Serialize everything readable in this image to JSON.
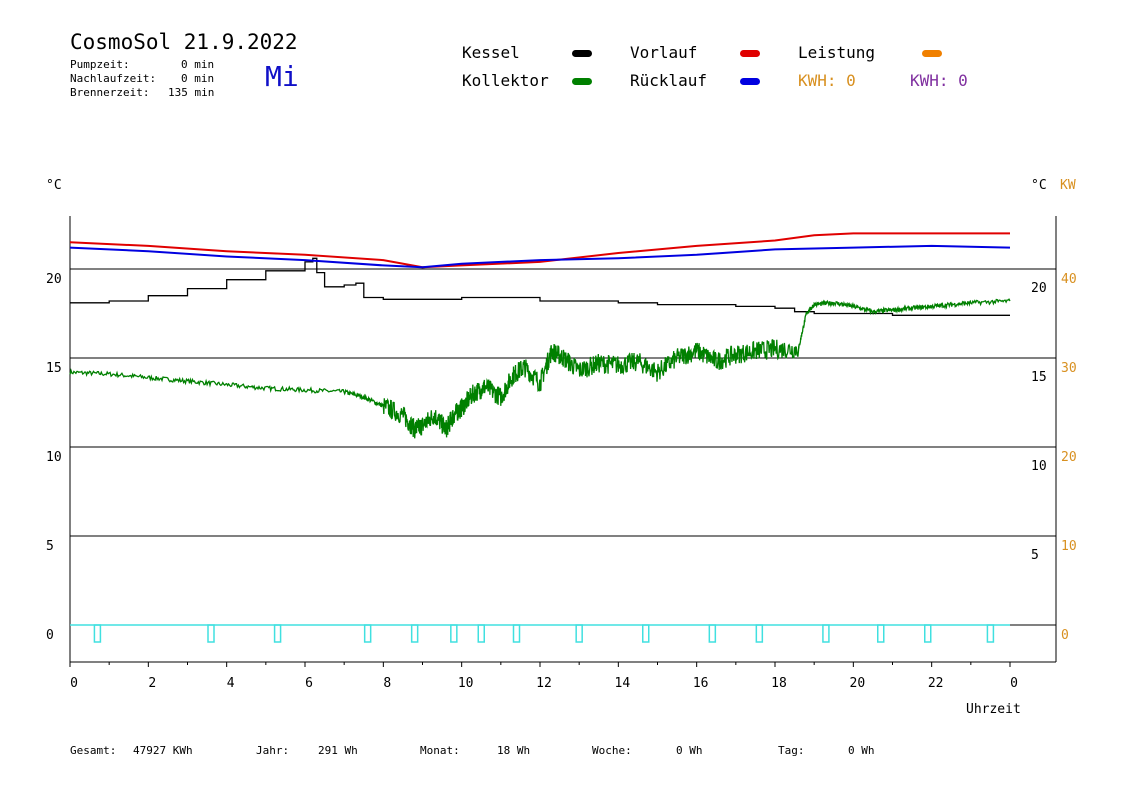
{
  "header": {
    "title": "CosmoSol 21.9.2022",
    "weekday": "Mi",
    "stats": [
      {
        "label": "Pumpzeit:",
        "value": "0 min"
      },
      {
        "label": "Nachlaufzeit:",
        "value": "0 min"
      },
      {
        "label": "Brennerzeit:",
        "value": "135 min"
      }
    ]
  },
  "legend": {
    "kessel": "Kessel",
    "vorlauf": "Vorlauf",
    "leistung": "Leistung",
    "kollektor": "Kollektor",
    "ruecklauf": "Rücklauf",
    "kwh1": "KWH: 0",
    "kwh2": "KWH: 0"
  },
  "axes": {
    "left_unit": "°C",
    "right_unit": "°C",
    "right_unit2": "KW",
    "xlabel": "Uhrzeit"
  },
  "footer": {
    "gesamt_label": "Gesamt:",
    "gesamt_value": "47927 KWh",
    "jahr_label": "Jahr:",
    "jahr_value": "291 Wh",
    "monat_label": "Monat:",
    "monat_value": "18 Wh",
    "woche_label": "Woche:",
    "woche_value": "0 Wh",
    "tag_label": "Tag:",
    "tag_value": "0 Wh"
  },
  "colors": {
    "kessel": "#000000",
    "kollektor": "#008000",
    "vorlauf": "#e00000",
    "ruecklauf": "#0000e0",
    "leistung": "#f08000",
    "kwh_orange": "#d89020",
    "kwh_purple": "#8030a0",
    "pump": "#40e0e0"
  },
  "chart_data": {
    "type": "line",
    "title": "CosmoSol 21.9.2022",
    "xlabel": "Uhrzeit",
    "ylabel": "°C",
    "xlim": [
      0,
      24
    ],
    "ylim": [
      -2,
      23
    ],
    "y2lim": [
      -4,
      46
    ],
    "y2label": "KW",
    "x_ticks": [
      "0",
      "2",
      "4",
      "6",
      "8",
      "10",
      "12",
      "14",
      "16",
      "18",
      "20",
      "22",
      "0"
    ],
    "y_left_ticks": [
      0,
      5,
      10,
      15,
      20
    ],
    "y_right_ticks": [
      5,
      10,
      15,
      20
    ],
    "y2_ticks": [
      0,
      10,
      20,
      30,
      40
    ],
    "grid": true,
    "series": [
      {
        "name": "Kessel",
        "x": [
          0,
          1,
          2,
          3,
          4,
          5,
          6,
          6.2,
          6.3,
          6.5,
          7,
          7.3,
          7.5,
          8,
          9,
          10,
          11,
          12,
          13,
          14,
          15,
          16,
          17,
          18,
          18.5,
          19,
          20,
          21,
          22,
          23,
          24
        ],
        "y": [
          18.1,
          18.2,
          18.5,
          18.9,
          19.4,
          19.9,
          20.4,
          20.6,
          19.8,
          19.0,
          19.1,
          19.2,
          18.4,
          18.3,
          18.3,
          18.4,
          18.4,
          18.2,
          18.2,
          18.1,
          18.0,
          18.0,
          17.9,
          17.8,
          17.6,
          17.5,
          17.5,
          17.4,
          17.4,
          17.4,
          17.4
        ]
      },
      {
        "name": "Kollektor",
        "x": [
          0,
          1,
          2,
          3,
          4,
          5,
          6,
          7,
          7.5,
          8,
          8.5,
          8.8,
          9,
          9.3,
          9.6,
          9.8,
          10,
          10.3,
          10.6,
          11,
          11.3,
          11.6,
          12,
          12.3,
          12.6,
          13,
          13.5,
          14,
          14.5,
          15,
          15.5,
          16,
          16.5,
          17,
          17.5,
          18,
          18.6,
          18.8,
          19,
          19.5,
          20,
          20.5,
          21,
          21.5,
          22,
          22.5,
          23,
          24
        ],
        "y": [
          14.2,
          14.1,
          13.9,
          13.7,
          13.5,
          13.3,
          13.2,
          13.1,
          12.8,
          12.3,
          11.8,
          11.0,
          11.2,
          11.8,
          11.0,
          11.8,
          12.2,
          13.0,
          13.4,
          12.8,
          14.0,
          14.5,
          13.6,
          15.4,
          15.0,
          14.3,
          14.7,
          14.6,
          14.8,
          14.2,
          15.0,
          15.4,
          14.8,
          15.2,
          15.4,
          15.5,
          15.5,
          17.5,
          18.0,
          18.1,
          17.9,
          17.6,
          17.7,
          17.8,
          17.9,
          18.0,
          18.1,
          18.2
        ]
      },
      {
        "name": "Vorlauf",
        "x": [
          0,
          2,
          4,
          6,
          8,
          9,
          10,
          12,
          14,
          16,
          18,
          19,
          20,
          22,
          24
        ],
        "y": [
          21.5,
          21.3,
          21.0,
          20.8,
          20.5,
          20.1,
          20.2,
          20.4,
          20.9,
          21.3,
          21.6,
          21.9,
          22.0,
          22.0,
          22.0
        ]
      },
      {
        "name": "Rücklauf",
        "x": [
          0,
          2,
          4,
          6,
          8,
          9,
          10,
          12,
          14,
          16,
          18,
          20,
          22,
          24
        ],
        "y": [
          21.2,
          21.0,
          20.7,
          20.5,
          20.2,
          20.1,
          20.3,
          20.5,
          20.6,
          20.8,
          21.1,
          21.2,
          21.3,
          21.2
        ]
      }
    ],
    "pump_markers_x": [
      0.7,
      3.6,
      5.3,
      7.6,
      8.8,
      9.8,
      10.5,
      11.4,
      13.0,
      14.7,
      16.4,
      17.6,
      19.3,
      20.7,
      21.9,
      23.5
    ]
  }
}
